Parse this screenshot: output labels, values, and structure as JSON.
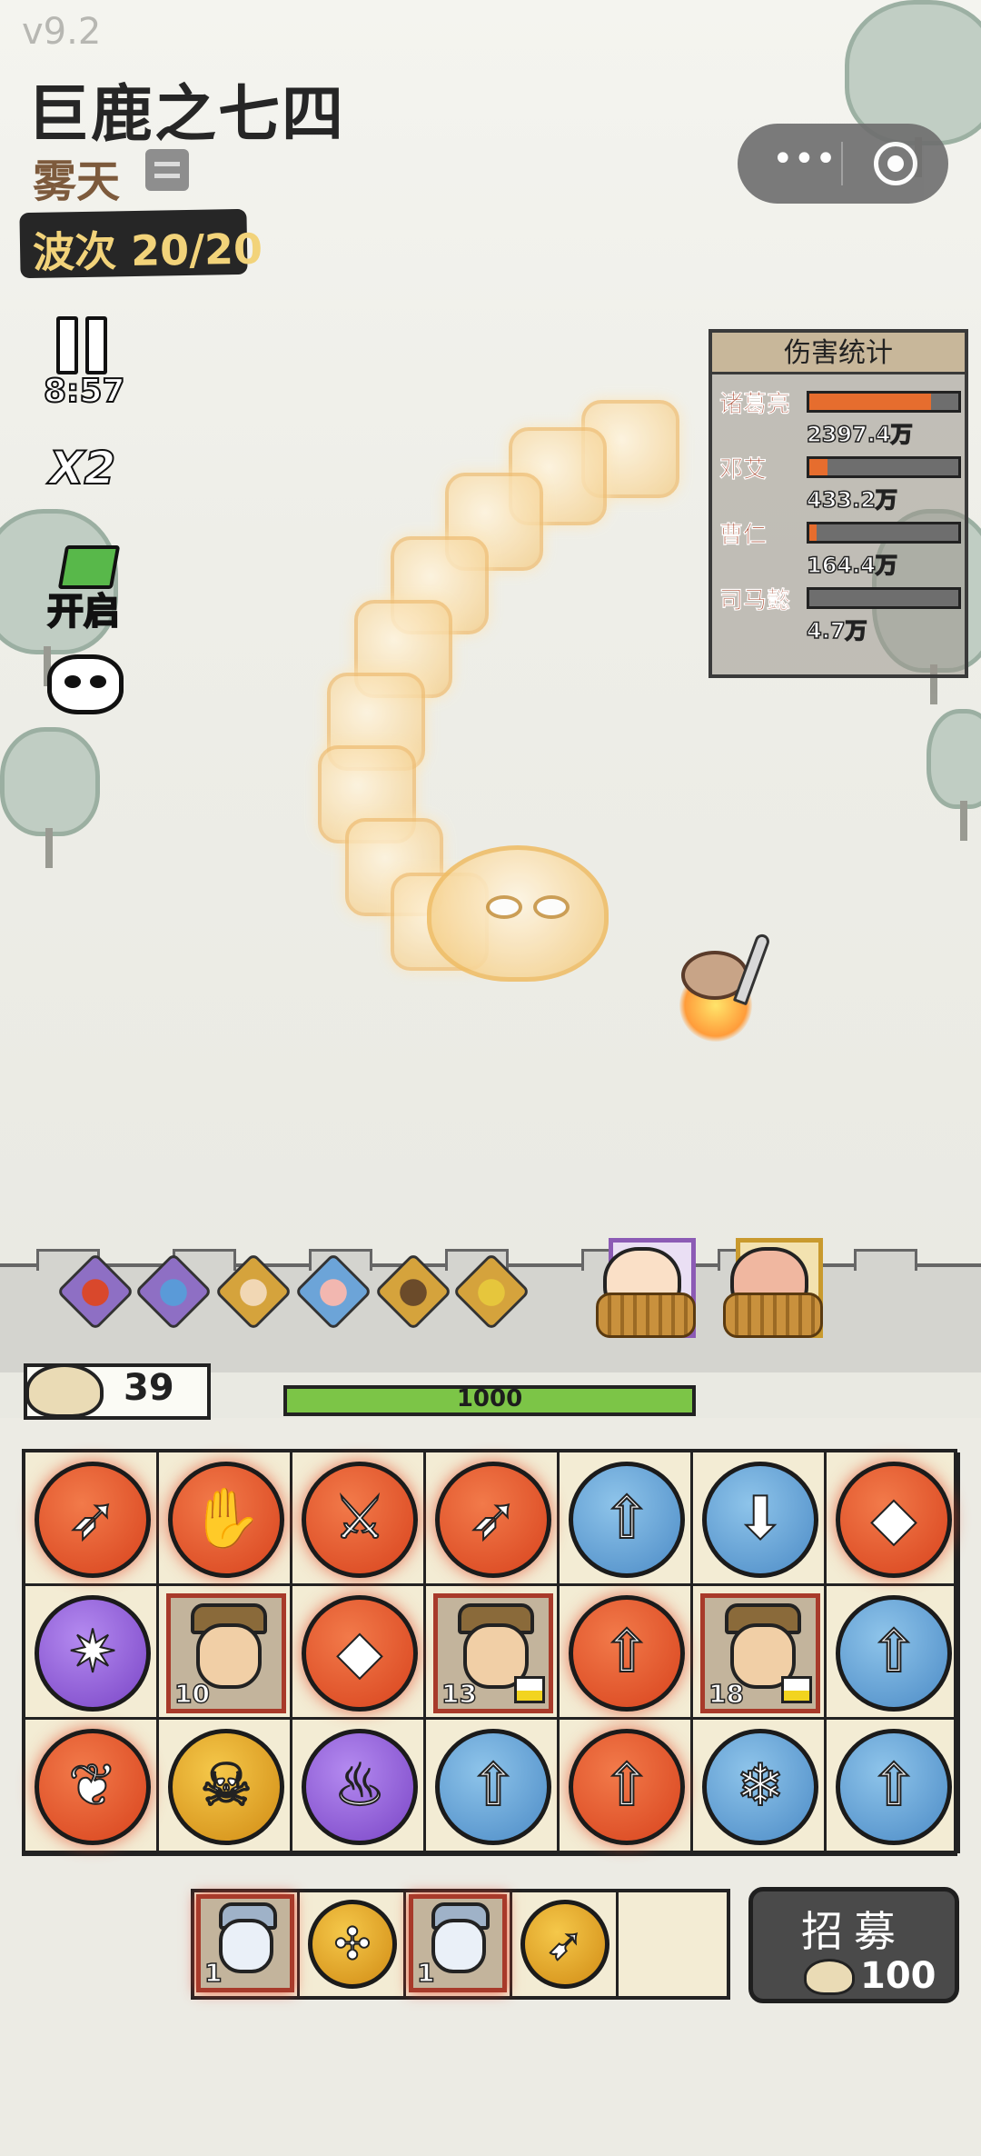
{
  "version": "v9.2",
  "level_title": "巨鹿之七四",
  "weather": "雾天",
  "wave": "波次 20/20",
  "timer": "8:57",
  "speed": "X2",
  "auto_label": "开启",
  "damage_stats": {
    "title": "伤害统计",
    "rows": [
      {
        "name": "诸葛亮",
        "value": "2397.4万",
        "fill": 0.82
      },
      {
        "name": "邓艾",
        "value": "433.2万",
        "fill": 0.12
      },
      {
        "name": "曹仁",
        "value": "164.4万",
        "fill": 0.05
      },
      {
        "name": "司马懿",
        "value": "4.7万",
        "fill": 0.0
      }
    ]
  },
  "coins": "39",
  "wall_hp": "1000",
  "wall_hp_fraction": 1.0,
  "board": {
    "rows": [
      [
        {
          "kind": "token",
          "color": "orange",
          "icon": "arrow-icon"
        },
        {
          "kind": "token",
          "color": "orange",
          "icon": "hand-icon"
        },
        {
          "kind": "token",
          "color": "orange",
          "icon": "sword-icon"
        },
        {
          "kind": "token",
          "color": "orange",
          "icon": "arrow-icon"
        },
        {
          "kind": "token",
          "color": "blue",
          "icon": "sword-up-icon"
        },
        {
          "kind": "token",
          "color": "blue",
          "icon": "boot-icon"
        },
        {
          "kind": "token",
          "color": "orange",
          "icon": "spike-icon"
        }
      ],
      [
        {
          "kind": "token",
          "color": "purple",
          "icon": "fire-up-icon"
        },
        {
          "kind": "hero",
          "level": "10"
        },
        {
          "kind": "token",
          "color": "orange",
          "icon": "spike-icon"
        },
        {
          "kind": "hero",
          "level": "13"
        },
        {
          "kind": "token",
          "color": "orange",
          "icon": "sword-up-icon"
        },
        {
          "kind": "hero",
          "level": "18"
        },
        {
          "kind": "token",
          "color": "blue",
          "icon": "sword-up-icon"
        }
      ],
      [
        {
          "kind": "token",
          "color": "orange",
          "icon": "peach-icon"
        },
        {
          "kind": "token",
          "color": "gold",
          "icon": "skull-icon"
        },
        {
          "kind": "token",
          "color": "purple",
          "icon": "fire-icon"
        },
        {
          "kind": "token",
          "color": "blue",
          "icon": "sword-up-icon"
        },
        {
          "kind": "token",
          "color": "orange",
          "icon": "sword-up-icon"
        },
        {
          "kind": "token",
          "color": "blue",
          "icon": "ice-icon"
        },
        {
          "kind": "token",
          "color": "blue",
          "icon": "sword-up-icon"
        }
      ]
    ]
  },
  "bench": [
    {
      "kind": "hero",
      "level": "1"
    },
    {
      "kind": "token",
      "color": "gold",
      "icon": "split-arrow-icon"
    },
    {
      "kind": "hero",
      "level": "1"
    },
    {
      "kind": "token",
      "color": "gold",
      "icon": "fire-arrow-icon"
    },
    {
      "kind": "empty"
    }
  ],
  "recruit": {
    "label": "招募",
    "cost": "100"
  },
  "colors": {
    "orange": "#d8431d",
    "blue": "#4c8bc6",
    "purple": "#7a45c6",
    "gold": "#d18b14",
    "hp": "#7cc547"
  }
}
